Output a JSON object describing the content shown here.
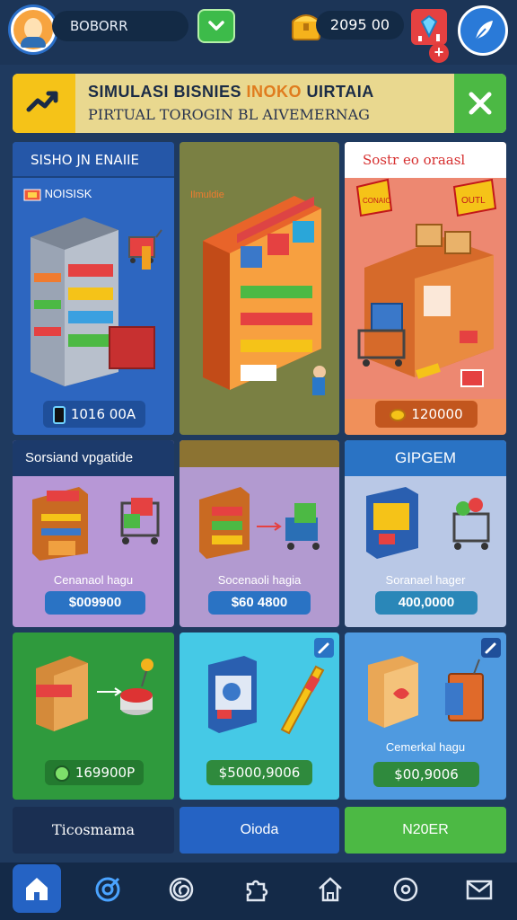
{
  "header": {
    "player_name": "BOBORR",
    "coins": "2095 00",
    "gem_plus": "+"
  },
  "banner": {
    "title_part1": "SIMULASI BISNIES ",
    "title_highlight": "INOKO",
    "title_part2": " UIRTAIA",
    "subtitle": "PIRTUAL TOROGIN BL AIVEMERNAG"
  },
  "cards": {
    "card1": {
      "header": "SISHO JN ENAIIE",
      "tag": "NOISISK",
      "price": "1016 00A"
    },
    "card2": {
      "sign": "Ilmuldie"
    },
    "card3": {
      "header": "Sostr eo oraasl",
      "price": "120000",
      "sign_left": "CONAIO",
      "sign_right": "OUTL"
    },
    "card4": {
      "header": "Sorsiand vpgatide",
      "subtitle": "Cenanaol hagu",
      "price": "$009900"
    },
    "card5": {
      "subtitle": "Socenaoli hagia",
      "price": "$60 4800"
    },
    "card6": {
      "header": "GIPGEM",
      "subtitle": "Soranael hager",
      "price": "400,0000"
    },
    "card7": {
      "price": "169900P"
    },
    "card8": {
      "price": "$5000,9006"
    },
    "card9": {
      "subtitle": "Cemerkal hagu",
      "price": "$00,9006"
    }
  },
  "tabs": [
    {
      "label": "Ticosmama"
    },
    {
      "label": "Oioda"
    },
    {
      "label": "N20ER"
    }
  ],
  "nav": [
    {
      "icon": "home-icon"
    },
    {
      "icon": "target-icon"
    },
    {
      "icon": "spiral-icon"
    },
    {
      "icon": "puzzle-icon"
    },
    {
      "icon": "house-outline-icon"
    },
    {
      "icon": "circle-dot-icon"
    },
    {
      "icon": "mail-icon"
    }
  ],
  "colors": {
    "background": "#1f3a5f",
    "accent_blue": "#2563c4",
    "accent_green": "#4cb944",
    "accent_orange": "#f07b2f",
    "price_blue": "#2a73c4",
    "price_green": "#2f9a3d"
  }
}
